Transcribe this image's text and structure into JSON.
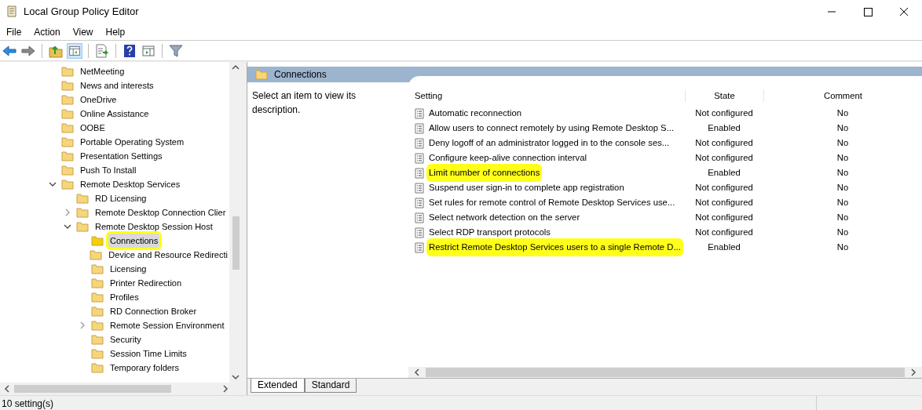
{
  "window": {
    "title": "Local Group Policy Editor"
  },
  "menu": [
    "File",
    "Action",
    "View",
    "Help"
  ],
  "tree": [
    {
      "label": "NetMeeting",
      "kind": "folder",
      "selected": false,
      "highlighted": false
    },
    {
      "label": "News and interests",
      "kind": "folder",
      "selected": false,
      "highlighted": false
    },
    {
      "label": "OneDrive",
      "kind": "folder",
      "selected": false,
      "highlighted": false
    },
    {
      "label": "Online Assistance",
      "kind": "folder",
      "selected": false,
      "highlighted": false
    },
    {
      "label": "OOBE",
      "kind": "folder",
      "selected": false,
      "highlighted": false
    },
    {
      "label": "Portable Operating System",
      "kind": "folder",
      "selected": false,
      "highlighted": false
    },
    {
      "label": "Presentation Settings",
      "kind": "folder",
      "selected": false,
      "highlighted": false
    },
    {
      "label": "Push To Install",
      "kind": "folder",
      "selected": false,
      "highlighted": false
    },
    {
      "label": "Remote Desktop Services",
      "kind": "branch",
      "expanded": true,
      "selected": false,
      "highlighted": false,
      "children": [
        {
          "label": "RD Licensing",
          "kind": "folder",
          "selected": false,
          "highlighted": false
        },
        {
          "label": "Remote Desktop Connection Clier",
          "kind": "branch",
          "expanded": false,
          "selected": false,
          "highlighted": false
        },
        {
          "label": "Remote Desktop Session Host",
          "kind": "branch",
          "expanded": true,
          "selected": false,
          "highlighted": false,
          "children": [
            {
              "label": "Connections",
              "kind": "folder",
              "selected": true,
              "highlighted": true
            },
            {
              "label": "Device and Resource Redirecti",
              "kind": "folder",
              "selected": false,
              "highlighted": false
            },
            {
              "label": "Licensing",
              "kind": "folder",
              "selected": false,
              "highlighted": false
            },
            {
              "label": "Printer Redirection",
              "kind": "folder",
              "selected": false,
              "highlighted": false
            },
            {
              "label": "Profiles",
              "kind": "folder",
              "selected": false,
              "highlighted": false
            },
            {
              "label": "RD Connection Broker",
              "kind": "folder",
              "selected": false,
              "highlighted": false
            },
            {
              "label": "Remote Session Environment",
              "kind": "branch",
              "expanded": false,
              "selected": false,
              "highlighted": false
            },
            {
              "label": "Security",
              "kind": "folder",
              "selected": false,
              "highlighted": false
            },
            {
              "label": "Session Time Limits",
              "kind": "folder",
              "selected": false,
              "highlighted": false
            },
            {
              "label": "Temporary folders",
              "kind": "folder",
              "selected": false,
              "highlighted": false
            }
          ]
        }
      ]
    }
  ],
  "details": {
    "header": "Connections",
    "description": "Select an item to view its description.",
    "columns": [
      "Setting",
      "State",
      "Comment"
    ],
    "rows": [
      {
        "setting": "Automatic reconnection",
        "state": "Not configured",
        "comment": "No",
        "highlighted": false
      },
      {
        "setting": "Allow users to connect remotely by using Remote Desktop S...",
        "state": "Enabled",
        "comment": "No",
        "highlighted": false
      },
      {
        "setting": "Deny logoff of an administrator logged in to the console ses...",
        "state": "Not configured",
        "comment": "No",
        "highlighted": false
      },
      {
        "setting": "Configure keep-alive connection interval",
        "state": "Not configured",
        "comment": "No",
        "highlighted": false
      },
      {
        "setting": "Limit number of connections",
        "state": "Enabled",
        "comment": "No",
        "highlighted": true
      },
      {
        "setting": "Suspend user sign-in to complete app registration",
        "state": "Not configured",
        "comment": "No",
        "highlighted": false
      },
      {
        "setting": "Set rules for remote control of Remote Desktop Services use...",
        "state": "Not configured",
        "comment": "No",
        "highlighted": false
      },
      {
        "setting": "Select network detection on the server",
        "state": "Not configured",
        "comment": "No",
        "highlighted": false
      },
      {
        "setting": "Select RDP transport protocols",
        "state": "Not configured",
        "comment": "No",
        "highlighted": false
      },
      {
        "setting": "Restrict Remote Desktop Services users to a single Remote D...",
        "state": "Enabled",
        "comment": "No",
        "highlighted": true
      }
    ],
    "tabs": [
      {
        "label": "Extended",
        "selected": true
      },
      {
        "label": "Standard",
        "selected": false
      }
    ]
  },
  "status_bar": "10 setting(s)"
}
